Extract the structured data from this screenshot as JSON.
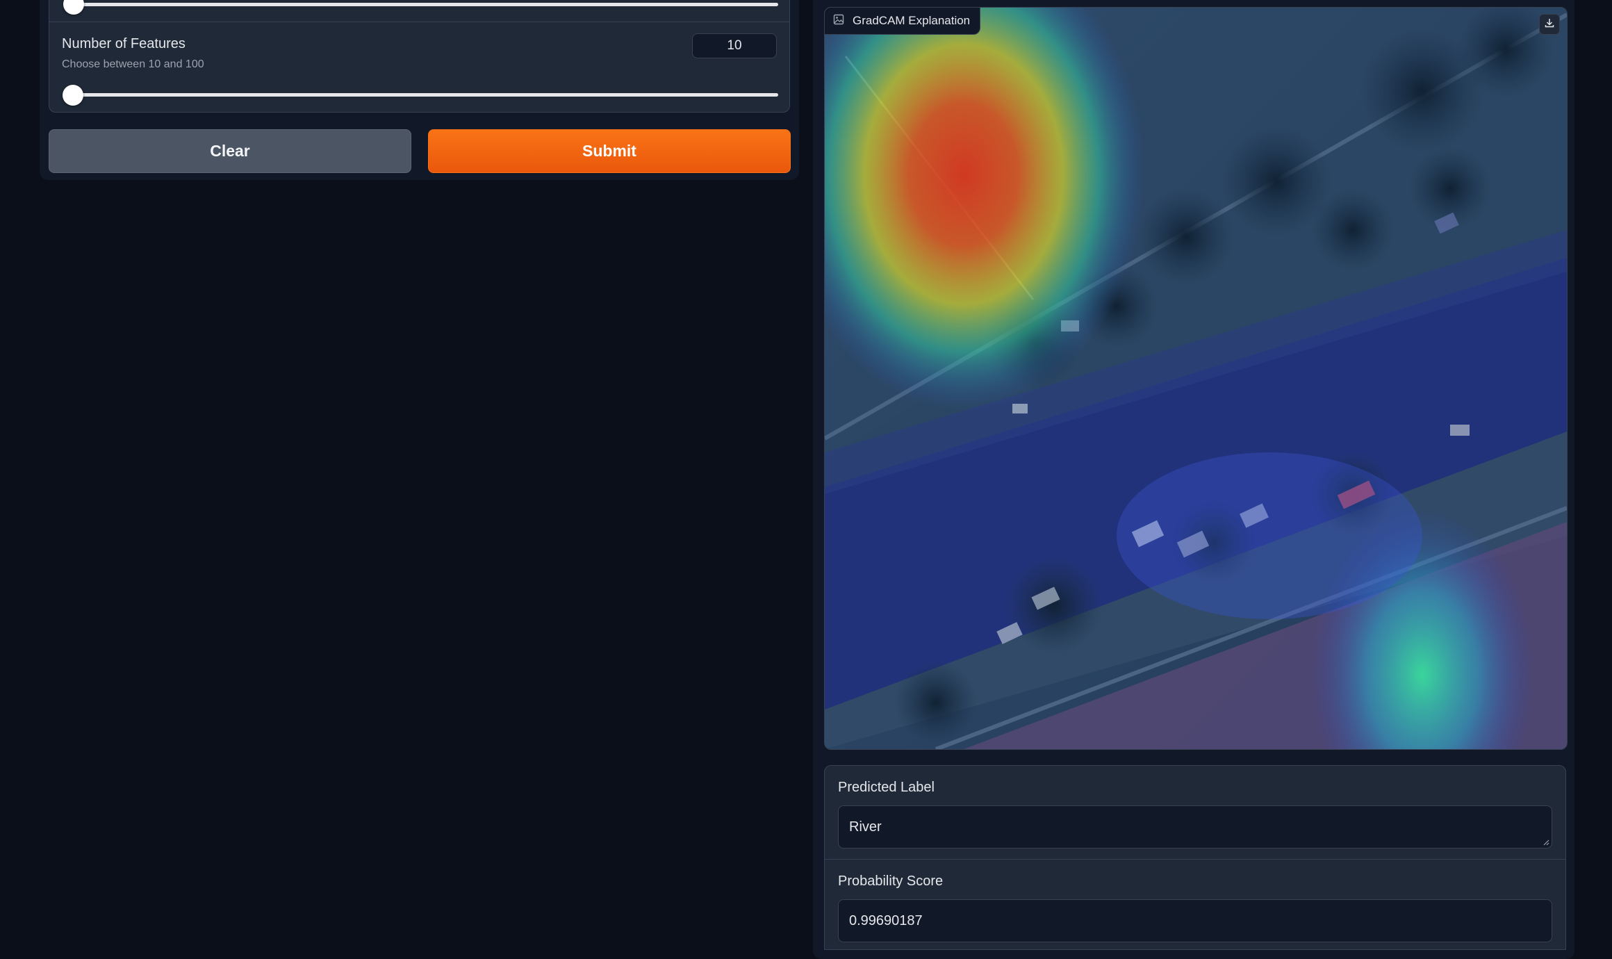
{
  "left": {
    "features_slider": {
      "label": "Number of Features",
      "info": "Choose between 10 and 100",
      "value": "10",
      "min": 10,
      "max": 100
    },
    "buttons": {
      "clear_label": "Clear",
      "submit_label": "Submit"
    }
  },
  "right": {
    "image": {
      "label": "GradCAM Explanation",
      "label_icon": "image-icon",
      "download_icon": "download-icon"
    },
    "predicted_label": {
      "title": "Predicted Label",
      "value": "River"
    },
    "probability": {
      "title": "Probability Score",
      "value": "0.99690187"
    }
  },
  "colors": {
    "background": "#0b0f19",
    "panel": "#1f2937",
    "accent": "#f97316",
    "clear_button": "#4b5563"
  }
}
